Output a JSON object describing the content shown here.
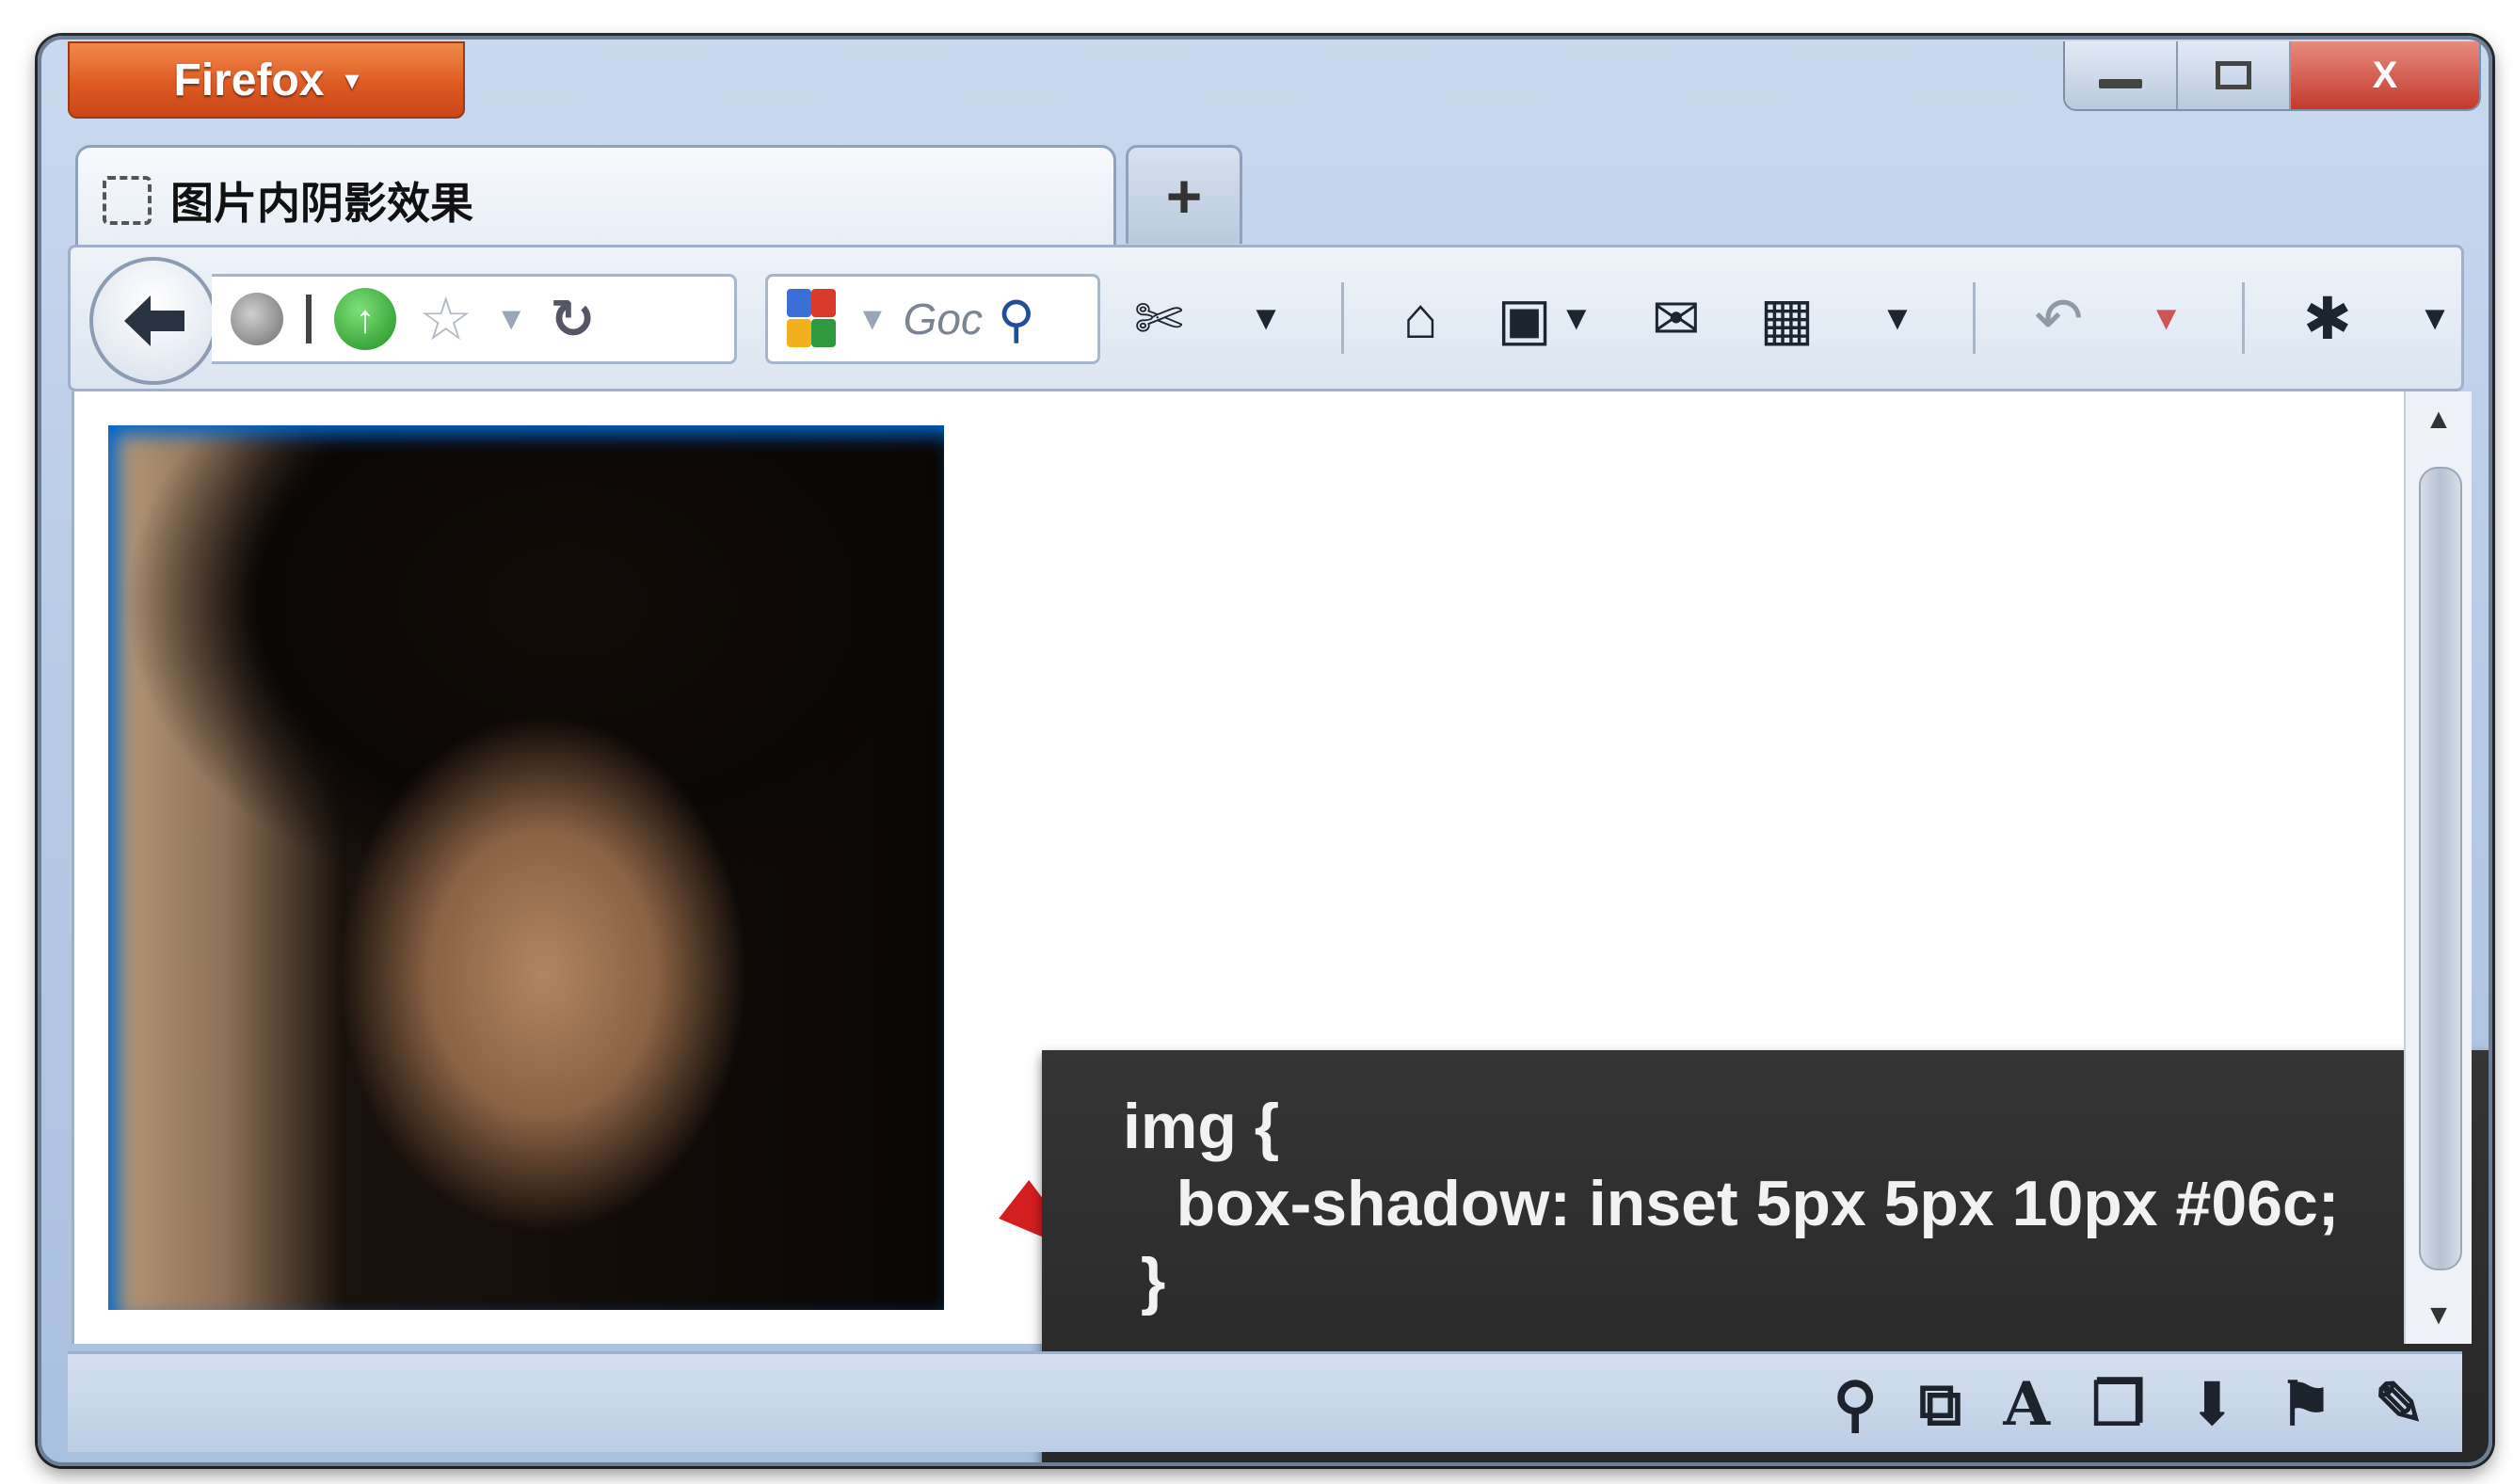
{
  "window": {
    "app_button_label": "Firefox",
    "app_button_caret": "▾",
    "controls": [
      "minimize-icon",
      "maximize-icon",
      "close-icon"
    ],
    "close_glyph": "X"
  },
  "tabs": {
    "active_title": "图片内阴影效果",
    "new_tab_glyph": "+"
  },
  "toolbar": {
    "back_glyph": "🡐",
    "search_placeholder": "Goc",
    "icons": [
      "cut-icon",
      "home-icon",
      "bookmark-icon",
      "mail-icon",
      "apps-icon",
      "undo-icon",
      "bug-icon"
    ]
  },
  "content": {
    "image_alt": "portrait photo",
    "code_lines": [
      "img {",
      "   box-shadow: inset 5px 5px 10px #06c;",
      " }"
    ],
    "shadow_color": "#0066cc"
  },
  "statusbar": {
    "icons": [
      "search-icon",
      "external-link-icon",
      "font-icon",
      "windows-icon",
      "download-icon",
      "flag-icon",
      "brush-icon"
    ],
    "font_glyph": "A"
  }
}
